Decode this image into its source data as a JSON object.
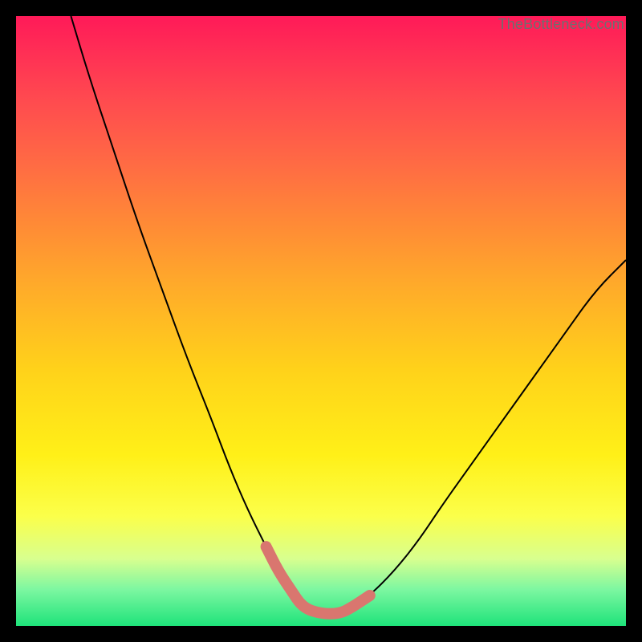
{
  "watermark": "TheBottleneck.com",
  "chart_data": {
    "type": "line",
    "title": "",
    "xlabel": "",
    "ylabel": "",
    "xlim": [
      0,
      100
    ],
    "ylim": [
      0,
      100
    ],
    "grid": false,
    "series": [
      {
        "name": "bottleneck-curve",
        "x": [
          9,
          12,
          16,
          20,
          24,
          28,
          32,
          35,
          38,
          41,
          43,
          45,
          47,
          50,
          53,
          55,
          58,
          62,
          66,
          70,
          75,
          80,
          85,
          90,
          95,
          100
        ],
        "y": [
          100,
          90,
          78,
          66,
          55,
          44,
          34,
          26,
          19,
          13,
          9,
          6,
          3,
          2,
          2,
          3,
          5,
          9,
          14,
          20,
          27,
          34,
          41,
          48,
          55,
          60
        ]
      }
    ],
    "highlight": {
      "name": "optimal-segment",
      "x": [
        41,
        43,
        45,
        47,
        50,
        53,
        55,
        58
      ],
      "y": [
        13,
        9,
        6,
        3,
        2,
        2,
        3,
        5
      ]
    }
  },
  "colors": {
    "curve": "#000000",
    "highlight": "#d9766f"
  }
}
